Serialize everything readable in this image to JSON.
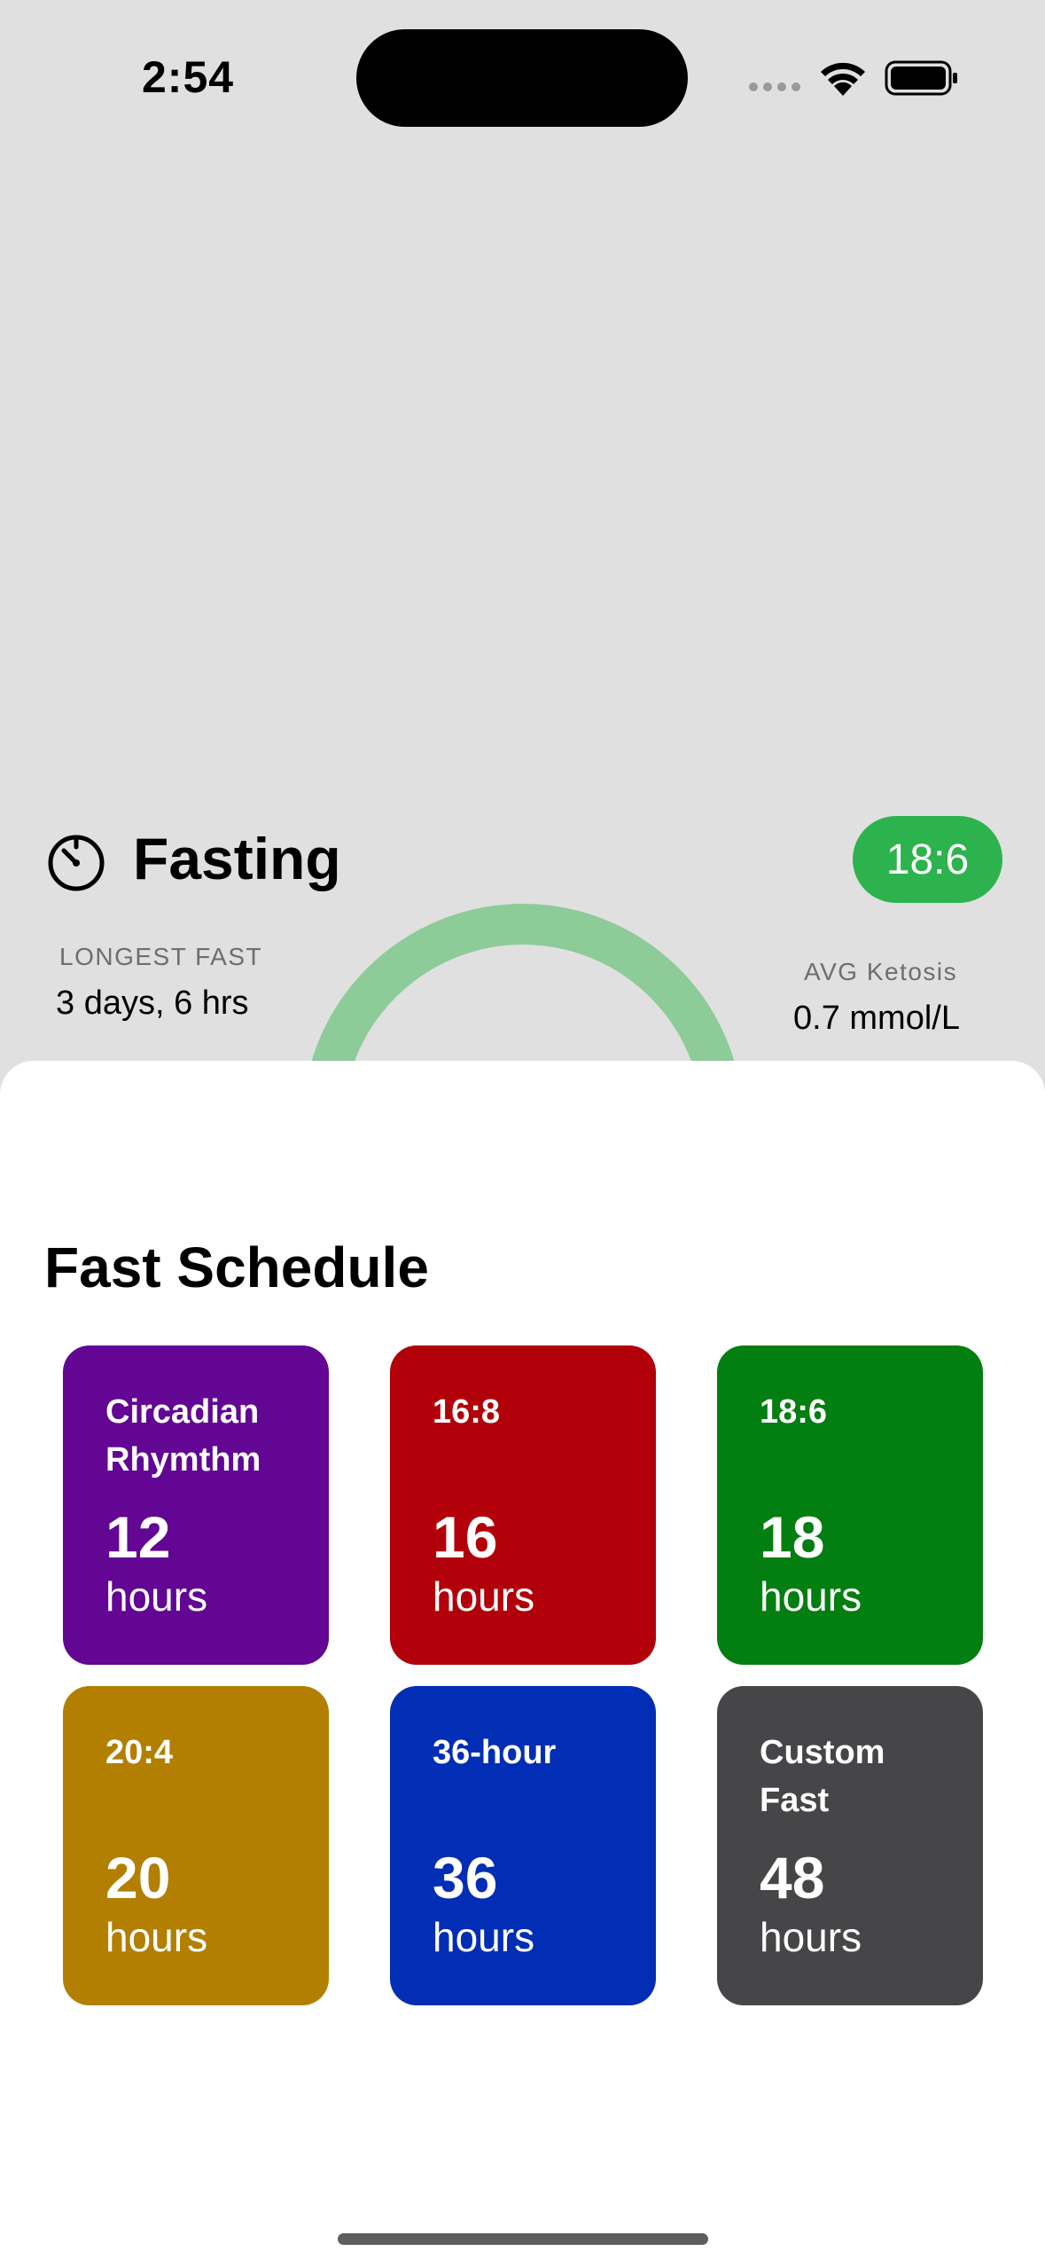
{
  "status_bar": {
    "time": "2:54"
  },
  "fasting_card": {
    "title": "Fasting",
    "plan_badge": "18:6",
    "badge_color": "#2db34d",
    "ring_color": "#8dcb98",
    "longest_fast": {
      "label": "LONGEST FAST",
      "value": "3 days, 6 hrs"
    },
    "avg_ketosis": {
      "label": "AVG Ketosis",
      "value": "0.7 mmol/L"
    }
  },
  "sheet": {
    "title": "Fast Schedule",
    "tiles": [
      {
        "name": "Circadian Rhymthm",
        "hours": "12",
        "unit": "hours",
        "color": "#620693"
      },
      {
        "name": "16:8",
        "hours": "16",
        "unit": "hours",
        "color": "#b10009"
      },
      {
        "name": "18:6",
        "hours": "18",
        "unit": "hours",
        "color": "#037e10"
      },
      {
        "name": "20:4",
        "hours": "20",
        "unit": "hours",
        "color": "#b27f00"
      },
      {
        "name": "36-hour",
        "hours": "36",
        "unit": "hours",
        "color": "#022db5"
      },
      {
        "name": "Custom Fast",
        "hours": "48",
        "unit": "hours",
        "color": "#464649"
      }
    ]
  }
}
